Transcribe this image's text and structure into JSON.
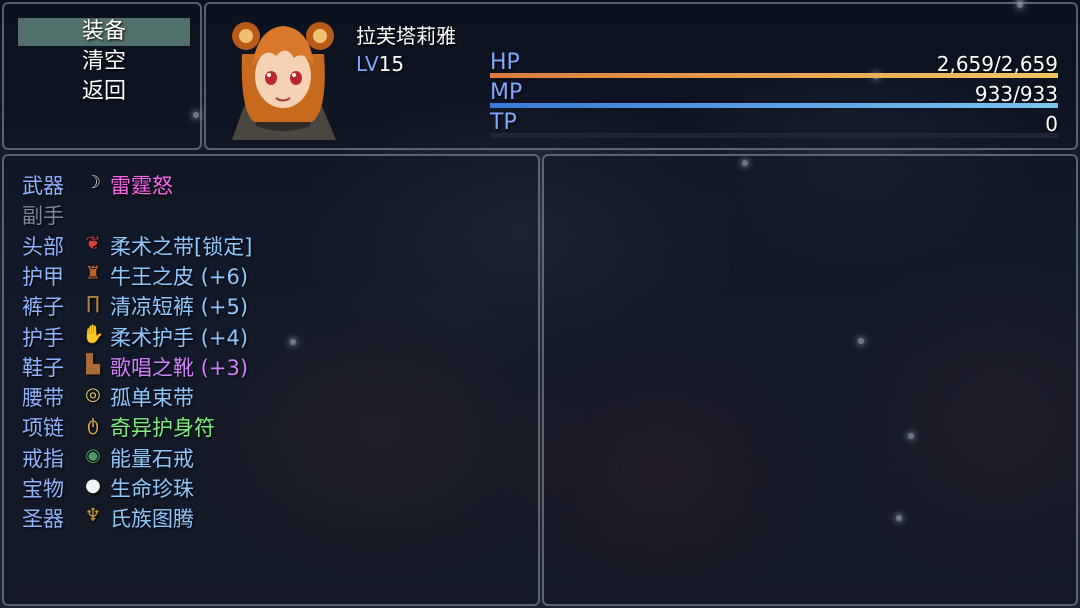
{
  "commands": [
    {
      "label": "装备",
      "selected": true
    },
    {
      "label": "清空",
      "selected": false
    },
    {
      "label": "返回",
      "selected": false
    }
  ],
  "actor": {
    "name": "拉芙塔莉雅",
    "level_label": "LV",
    "level": "15",
    "hp": {
      "label": "HP",
      "value": "2,659/2,659",
      "ratio": 1.0,
      "color_from": "#e07a3a",
      "color_to": "#f0c860"
    },
    "mp": {
      "label": "MP",
      "value": "933/933",
      "ratio": 1.0,
      "color_from": "#3a78d8",
      "color_to": "#7ec4f0"
    },
    "tp": {
      "label": "TP",
      "value": "0",
      "ratio": 0.0,
      "color_from": "#3ab070",
      "color_to": "#8ae0a0"
    }
  },
  "equipment": [
    {
      "slot": "武器",
      "icon": "weapon-icon",
      "glyph": "☽",
      "glyph_color": "#cfd8e8",
      "item": "雷霆怒",
      "item_color": "#ff63e8"
    },
    {
      "slot": "副手",
      "icon": "",
      "glyph": "",
      "glyph_color": "",
      "item": "",
      "item_color": "#ffffff",
      "empty": true
    },
    {
      "slot": "头部",
      "icon": "scarf-icon",
      "glyph": "❦",
      "glyph_color": "#d84040",
      "item": "柔术之带[锁定]",
      "item_color": "#8fc8ff"
    },
    {
      "slot": "护甲",
      "icon": "armor-icon",
      "glyph": "♜",
      "glyph_color": "#c0602c",
      "item": "牛王之皮 (+6)",
      "item_color": "#8fc8ff"
    },
    {
      "slot": "裤子",
      "icon": "pants-icon",
      "glyph": "∏",
      "glyph_color": "#b08040",
      "item": "清凉短裤 (+5)",
      "item_color": "#8fc8ff"
    },
    {
      "slot": "护手",
      "icon": "gauntlet-icon",
      "glyph": "✋",
      "glyph_color": "#c08a3a",
      "item": "柔术护手 (+4)",
      "item_color": "#8fc8ff"
    },
    {
      "slot": "鞋子",
      "icon": "boots-icon",
      "glyph": "▙",
      "glyph_color": "#a86a3a",
      "item": "歌唱之靴 (+3)",
      "item_color": "#d080ff"
    },
    {
      "slot": "腰带",
      "icon": "belt-icon",
      "glyph": "◎",
      "glyph_color": "#e8c870",
      "item": "孤单束带",
      "item_color": "#8fc8ff"
    },
    {
      "slot": "项链",
      "icon": "necklace-icon",
      "glyph": "ტ",
      "glyph_color": "#e8b040",
      "item": "奇异护身符",
      "item_color": "#7cf07c"
    },
    {
      "slot": "戒指",
      "icon": "ring-icon",
      "glyph": "◉",
      "glyph_color": "#4a9a6a",
      "item": "能量石戒",
      "item_color": "#8fc8ff"
    },
    {
      "slot": "宝物",
      "icon": "pearl-icon",
      "glyph": "●",
      "glyph_color": "#f4f4f4",
      "item": "生命珍珠",
      "item_color": "#8fc8ff"
    },
    {
      "slot": "圣器",
      "icon": "totem-icon",
      "glyph": "♆",
      "glyph_color": "#d0a040",
      "item": "氏族图腾",
      "item_color": "#8fc8ff"
    }
  ]
}
